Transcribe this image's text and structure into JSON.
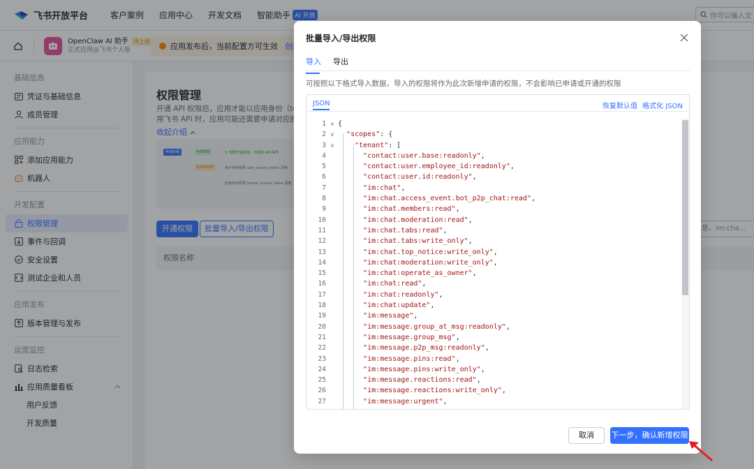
{
  "brand": {
    "name": "飞书开放平台",
    "logo_icon": "feishu-bird-logo"
  },
  "topnav": {
    "items": [
      "客户案例",
      "应用中心",
      "开发文档",
      "智能助手"
    ],
    "ai_badge": "AI 开放",
    "search_placeholder": "你可以输入文"
  },
  "appbar": {
    "app_name": "OpenClaw AI 助手",
    "app_tag": "待上线",
    "app_sub": "正式应用@飞书个人版",
    "notice": "应用发布后，当前配置方可生效",
    "notice_link": "创建"
  },
  "sidebar": {
    "groups": [
      {
        "title": "基础信息",
        "items": [
          {
            "label": "凭证与基础信息",
            "icon": "id-card-icon"
          },
          {
            "label": "成员管理",
            "icon": "person-icon"
          }
        ]
      },
      {
        "title": "应用能力",
        "items": [
          {
            "label": "添加应用能力",
            "icon": "grid-icon"
          },
          {
            "label": "机器人",
            "icon": "bot-icon"
          }
        ]
      },
      {
        "title": "开发配置",
        "items": [
          {
            "label": "权限管理",
            "icon": "lock-icon",
            "active": true
          },
          {
            "label": "事件与回调",
            "icon": "event-icon"
          },
          {
            "label": "安全设置",
            "icon": "shield-icon"
          },
          {
            "label": "测试企业和人员",
            "icon": "test-icon"
          }
        ]
      },
      {
        "title": "应用发布",
        "items": [
          {
            "label": "版本管理与发布",
            "icon": "upload-icon"
          }
        ]
      },
      {
        "title": "运营监控",
        "items": [
          {
            "label": "日志检索",
            "icon": "log-icon"
          },
          {
            "label": "应用质量看板",
            "icon": "chart-icon"
          }
        ]
      }
    ],
    "sub_items": [
      "用户反馈",
      "开发质量"
    ]
  },
  "main": {
    "title": "权限管理",
    "desc_line1": "开通 API 权限后，应用才能以应用身份（tenant",
    "desc_line2": "用飞书 API 时，应用可能还需要申请对应的数据",
    "collapse": "收起介绍",
    "flow": {
      "step1": "申请权限",
      "step2": "免审权限",
      "step3": "需审核权限",
      "step4": "① 权限开通成功，可调用 API/事件",
      "step5": "用户身份权限 user_access_token 调用",
      "step6": "应用身份权限 tenant_access_token 调用"
    },
    "btn_open": "开通权限",
    "btn_batch": "批量导入/导出权限",
    "table_col": "权限名称",
    "search_placeholder": "息、im:cha..."
  },
  "modal": {
    "title": "批量导入/导出权限",
    "tabs": [
      "导入",
      "导出"
    ],
    "hint": "可按照以下格式导入数据，导入的权限将作为此次新增申请的权限，不会影响已申请或开通的权限",
    "editor_tab": "JSON",
    "reset": "恢复默认值",
    "format": "格式化 JSON",
    "cancel": "取消",
    "confirm": "下一步，确认新增权限"
  },
  "code_lines": [
    {
      "n": "1",
      "fold": "∨",
      "text": "{"
    },
    {
      "n": "2",
      "fold": "∨",
      "text": "  \"scopes\": {"
    },
    {
      "n": "3",
      "fold": "∨",
      "text": "    \"tenant\": ["
    },
    {
      "n": "4",
      "fold": "",
      "text": "      \"contact:user.base:readonly\","
    },
    {
      "n": "5",
      "fold": "",
      "text": "      \"contact:user.employee_id:readonly\","
    },
    {
      "n": "6",
      "fold": "",
      "text": "      \"contact:user.id:readonly\","
    },
    {
      "n": "7",
      "fold": "",
      "text": "      \"im:chat\","
    },
    {
      "n": "8",
      "fold": "",
      "text": "      \"im:chat.access_event.bot_p2p_chat:read\","
    },
    {
      "n": "9",
      "fold": "",
      "text": "      \"im:chat.members:read\","
    },
    {
      "n": "10",
      "fold": "",
      "text": "      \"im:chat.moderation:read\","
    },
    {
      "n": "11",
      "fold": "",
      "text": "      \"im:chat.tabs:read\","
    },
    {
      "n": "12",
      "fold": "",
      "text": "      \"im:chat.tabs:write_only\","
    },
    {
      "n": "13",
      "fold": "",
      "text": "      \"im:chat.top_notice:write_only\","
    },
    {
      "n": "14",
      "fold": "",
      "text": "      \"im:chat:moderation:write_only\","
    },
    {
      "n": "15",
      "fold": "",
      "text": "      \"im:chat:operate_as_owner\","
    },
    {
      "n": "16",
      "fold": "",
      "text": "      \"im:chat:read\","
    },
    {
      "n": "17",
      "fold": "",
      "text": "      \"im:chat:readonly\","
    },
    {
      "n": "18",
      "fold": "",
      "text": "      \"im:chat:update\","
    },
    {
      "n": "19",
      "fold": "",
      "text": "      \"im:message\","
    },
    {
      "n": "20",
      "fold": "",
      "text": "      \"im:message.group_at_msg:readonly\","
    },
    {
      "n": "21",
      "fold": "",
      "text": "      \"im:message.group_msg\","
    },
    {
      "n": "22",
      "fold": "",
      "text": "      \"im:message.p2p_msg:readonly\","
    },
    {
      "n": "23",
      "fold": "",
      "text": "      \"im:message.pins:read\","
    },
    {
      "n": "24",
      "fold": "",
      "text": "      \"im:message.pins:write_only\","
    },
    {
      "n": "25",
      "fold": "",
      "text": "      \"im:message.reactions:read\","
    },
    {
      "n": "26",
      "fold": "",
      "text": "      \"im:message.reactions:write_only\","
    },
    {
      "n": "27",
      "fold": "",
      "text": "      \"im:message:urgent\","
    }
  ],
  "colors": {
    "accent": "#3370ff",
    "string": "#a31515",
    "annotation_arrow": "#e02020"
  }
}
